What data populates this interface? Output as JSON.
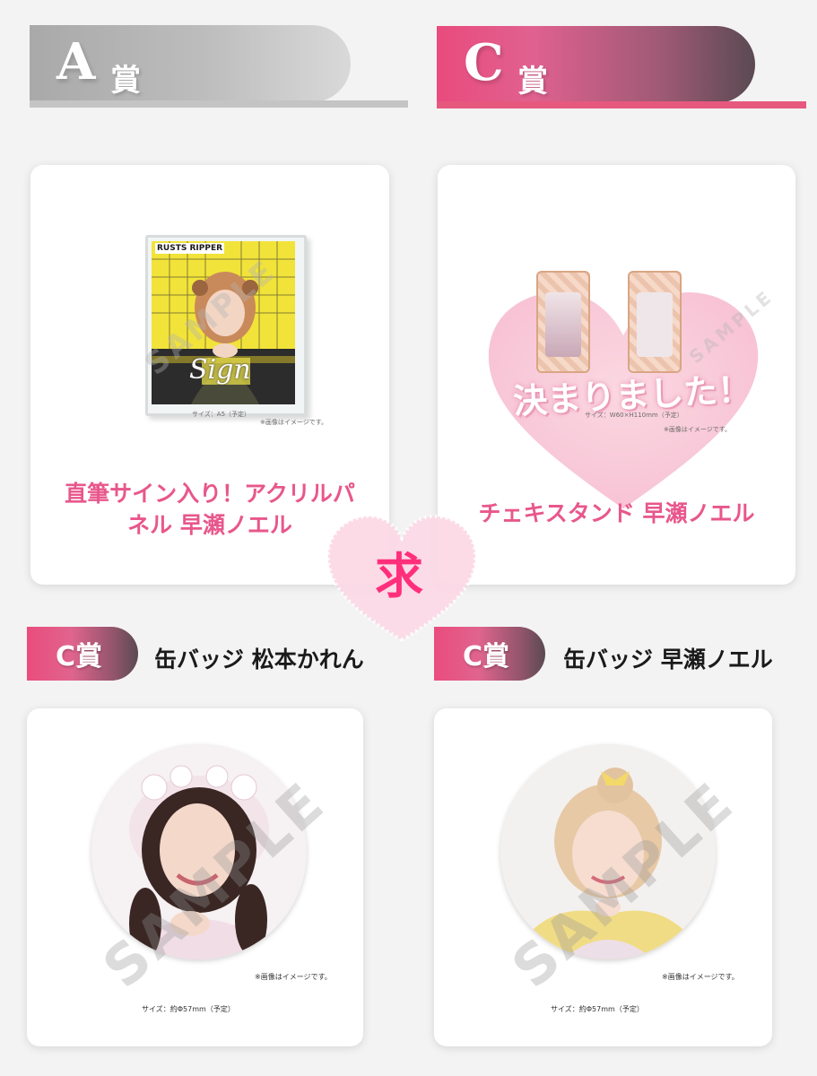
{
  "sections": {
    "a_prize": {
      "banner_letter": "A",
      "banner_kanji": "賞",
      "item_name_line1": "直筆サイン入り！アクリルパ",
      "item_name_line2": "ネル 早瀬ノエル",
      "size_note": "サイズ：A5（予定）",
      "image_note": "※画像はイメージです。",
      "sign_text": "Sign",
      "panel_logo": "RUSTS RIPPER",
      "watermark": "SAMPLE"
    },
    "c_prize_top": {
      "banner_letter": "C",
      "banner_kanji": "賞",
      "item_name": "チェキスタンド 早瀬ノエル",
      "overlay_text": "決まりました！",
      "size_note": "サイズ：W60×H110mm（予定）",
      "image_note": "※画像はイメージです。",
      "watermark": "SAMPLE"
    },
    "c_badge_left": {
      "label": "C賞",
      "item_name": "缶バッジ 松本かれん",
      "size_note": "サイズ：約Φ57mm（予定）",
      "image_note": "※画像はイメージです。",
      "watermark": "SAMPLE"
    },
    "c_badge_right": {
      "label": "C賞",
      "item_name": "缶バッジ 早瀬ノエル",
      "size_note": "サイズ：約Φ57mm（予定）",
      "image_note": "※画像はイメージです。",
      "watermark": "SAMPLE"
    }
  },
  "center_stamp": {
    "glyph": "求"
  },
  "colors": {
    "pink": "#e8578b",
    "gray_banner": "#b8b8b8",
    "background": "#f4f3f3"
  }
}
